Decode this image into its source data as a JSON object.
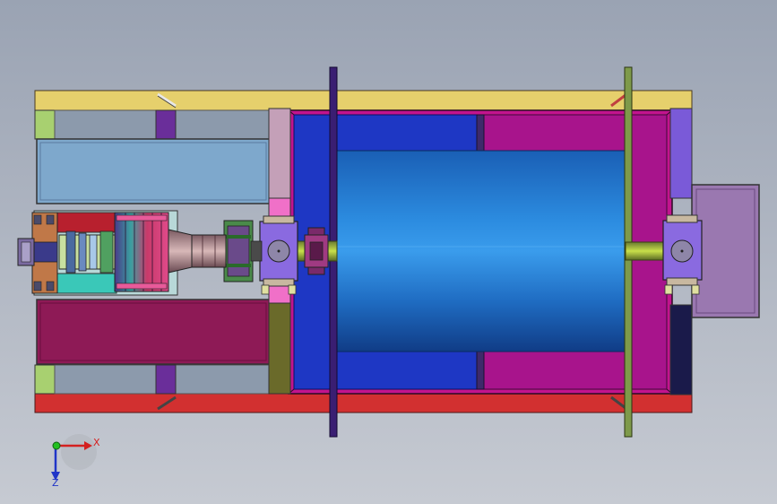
{
  "viewport": {
    "background_top": "#9aa3b3",
    "background_bottom": "#c6cad2"
  },
  "triad": {
    "x_label": "X",
    "z_label": "Z",
    "x_color": "#d42020",
    "z_color": "#2035c8",
    "origin_color": "#22c020"
  },
  "colors": {
    "frame_top": "#e6d06c",
    "frame_bottom": "#d23030",
    "panel_light": "#7ea8cc",
    "panel_dark": "#8e1a56",
    "drum": "#2a86d8",
    "bay_blue": "#1e37c4",
    "bay_magenta": "#a8148c",
    "plate_violet": "#3a1e72",
    "plate_olive": "#7e9a4a",
    "bearing_block": "#8a6ae0",
    "motor_mount": "#b8d8d8"
  }
}
